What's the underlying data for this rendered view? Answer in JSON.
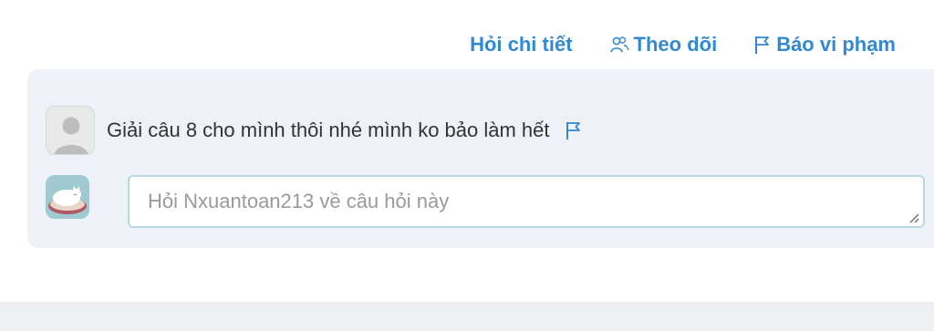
{
  "actions": {
    "ask_detail_label": "Hỏi chi tiết",
    "follow_label": "Theo dõi",
    "report_label": "Báo vi phạm"
  },
  "comment": {
    "text": "Giải câu 8 cho mình thôi nhé mình ko bảo làm hết"
  },
  "reply": {
    "placeholder": "Hỏi Nxuantoan213 về câu hỏi này"
  },
  "colors": {
    "accent": "#3189d6",
    "panel_background": "#eef2f8",
    "input_border": "#b9d6e3"
  },
  "icons": {
    "follow": "users-icon",
    "report": "flag-icon",
    "comment_report": "flag-icon",
    "default_avatar": "user-silhouette-icon",
    "user_avatar": "sleeping-cat-avatar"
  }
}
